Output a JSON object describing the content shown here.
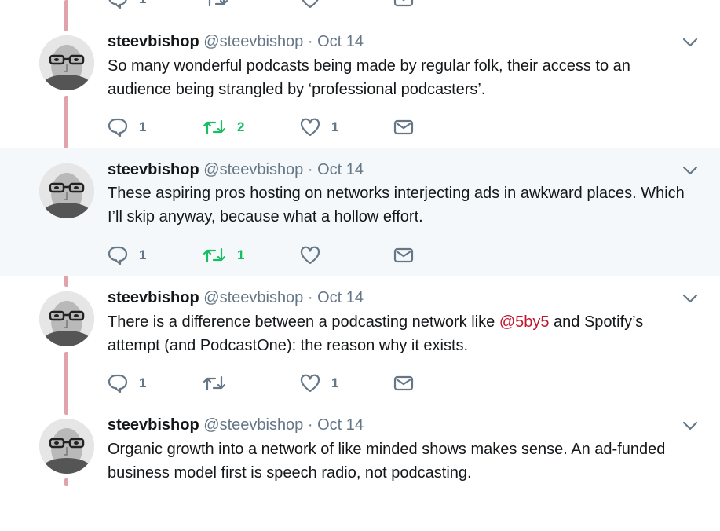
{
  "tweets": [
    {
      "name": "steevbishop",
      "handle": "@steevbishop",
      "date": "Oct 14",
      "text_parts": [
        "So many wonderful podcasts being made by regular folk, their access to an audience being strangled by ‘professional podcasters’."
      ],
      "reply_count": "1",
      "retweet_count": "2",
      "like_count": "1",
      "retweeted": true,
      "highlighted": false
    },
    {
      "name": "steevbishop",
      "handle": "@steevbishop",
      "date": "Oct 14",
      "text_parts": [
        "These aspiring pros hosting on networks interjecting ads in awkward places. Which I’ll skip anyway, because what a hollow effort."
      ],
      "reply_count": "1",
      "retweet_count": "1",
      "like_count": "",
      "retweeted": true,
      "highlighted": true
    },
    {
      "name": "steevbishop",
      "handle": "@steevbishop",
      "date": "Oct 14",
      "text_before": "There is a difference between a podcasting network like ",
      "mention": "@5by5",
      "text_after": " and Spotify’s attempt (and PodcastOne): the reason why it exists.",
      "reply_count": "1",
      "retweet_count": "",
      "like_count": "1",
      "retweeted": false,
      "highlighted": false
    },
    {
      "name": "steevbishop",
      "handle": "@steevbishop",
      "date": "Oct 14",
      "text_parts": [
        "Organic growth into a network of like minded shows makes sense. An ad-funded business model first is speech radio, not podcasting."
      ],
      "highlighted": false
    }
  ],
  "previous_tweet": {
    "reply_count": "1"
  },
  "colors": {
    "thread_line": "#e0a3ab",
    "retweet_green": "#17bf63",
    "icon_gray": "#657786",
    "mention": "#c0172f",
    "highlight_bg": "#f5f8fa"
  }
}
